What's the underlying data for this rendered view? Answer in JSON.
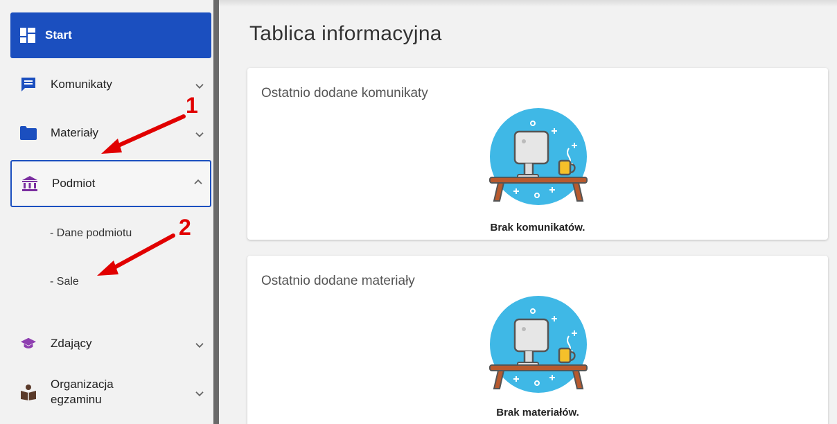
{
  "sidebar": {
    "start_label": "Start",
    "items": [
      {
        "label": "Komunikaty"
      },
      {
        "label": "Materiały"
      },
      {
        "label": "Podmiot"
      },
      {
        "label": "Zdający"
      },
      {
        "label": "Organizacja egzaminu"
      }
    ],
    "subitems": [
      {
        "label": "- Dane podmiotu"
      },
      {
        "label": "- Sale"
      }
    ]
  },
  "main": {
    "title": "Tablica informacyjna",
    "cards": [
      {
        "title": "Ostatnio dodane komunikaty",
        "message": "Brak komunikatów."
      },
      {
        "title": "Ostatnio dodane materiały",
        "message": "Brak materiałów."
      }
    ]
  },
  "annotations": [
    "1",
    "2"
  ],
  "colors": {
    "accent": "#1b4fbf",
    "podmiot_icon": "#7b2fa0",
    "zdajacy_icon": "#8e3fb0",
    "organizacja_icon": "#5a3a2a",
    "annotation": "#e10000",
    "illustration_bg": "#3fb8e6"
  },
  "icons": {
    "start": "dashboard-icon",
    "komunikaty": "message-icon",
    "materialy": "folder-icon",
    "podmiot": "institution-icon",
    "zdajacy": "graduation-cap-icon",
    "organizacja": "reader-icon"
  }
}
